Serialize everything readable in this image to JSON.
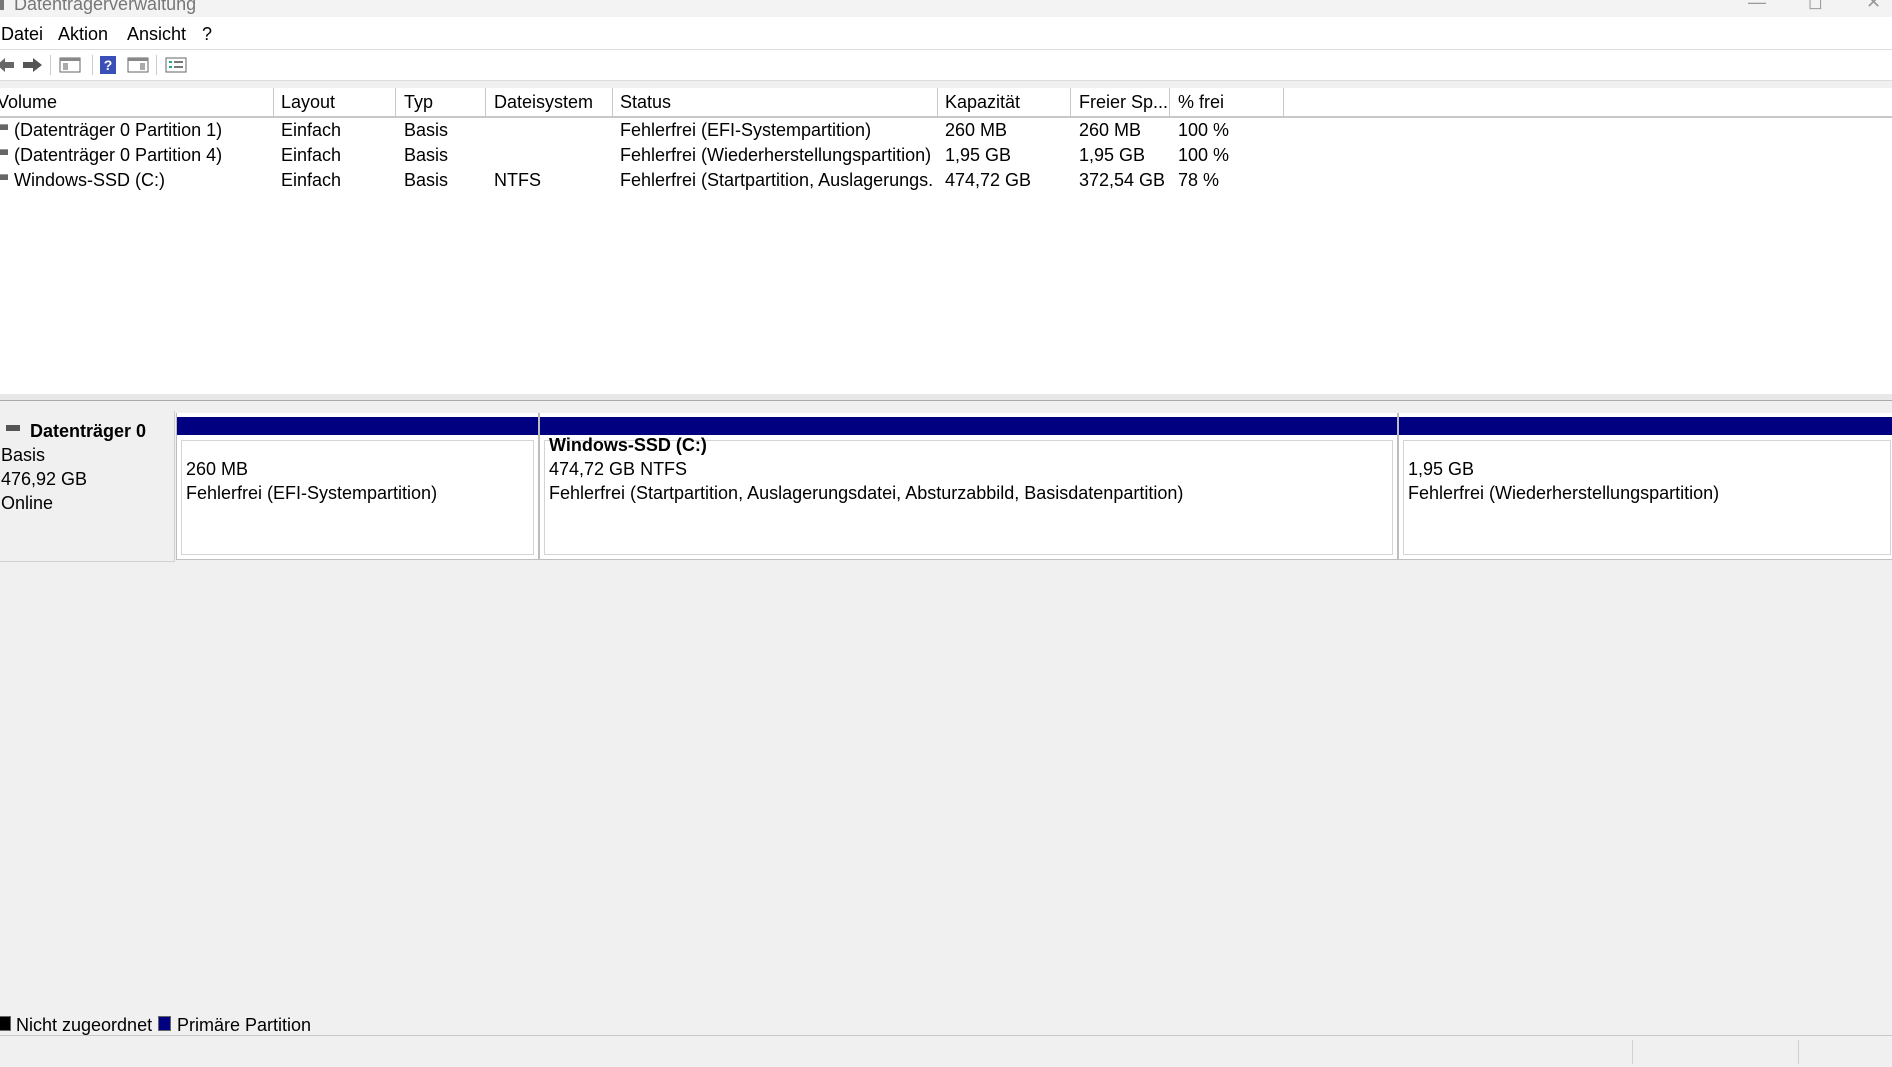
{
  "window": {
    "title": "Datenträgerverwaltung",
    "minimize_symbol": "—",
    "maximize_symbol": "◻",
    "close_symbol": "✕"
  },
  "menu": [
    {
      "label": "Datei"
    },
    {
      "label": "Aktion"
    },
    {
      "label": "Ansicht"
    },
    {
      "label": "?"
    }
  ],
  "toolbar": {
    "buttons": [
      {
        "icon": "back-arrow-icon",
        "glyph": "⇦"
      },
      {
        "icon": "forward-arrow-icon",
        "glyph": "➡"
      },
      {
        "icon": "console-tree-icon",
        "glyph": "▤"
      },
      {
        "icon": "help-icon",
        "glyph": "?"
      },
      {
        "icon": "action-pane-icon",
        "glyph": "▥"
      },
      {
        "icon": "properties-icon",
        "glyph": "☰"
      }
    ]
  },
  "volume_list": {
    "columns": [
      "Volume",
      "Layout",
      "Typ",
      "Dateisystem",
      "Status",
      "Kapazität",
      "Freier Sp...",
      "% frei"
    ],
    "rows": [
      [
        "(Datenträger 0 Partition 1)",
        "Einfach",
        "Basis",
        "",
        "Fehlerfrei (EFI-Systempartition)",
        "260 MB",
        "260 MB",
        "100 %"
      ],
      [
        "(Datenträger 0 Partition 4)",
        "Einfach",
        "Basis",
        "",
        "Fehlerfrei (Wiederherstellungspartition)",
        "1,95 GB",
        "1,95 GB",
        "100 %"
      ],
      [
        "Windows-SSD (C:)",
        "Einfach",
        "Basis",
        "NTFS",
        "Fehlerfrei (Startpartition, Auslagerungs...",
        "474,72 GB",
        "372,54 GB",
        "78 %"
      ]
    ]
  },
  "disk": {
    "name": "Datenträger 0",
    "type": "Basis",
    "size": "476,92 GB",
    "state": "Online",
    "partitions": [
      {
        "name": "",
        "size": "260 MB",
        "status": "Fehlerfrei (EFI-Systempartition)"
      },
      {
        "name": "Windows-SSD  (C:)",
        "size": "474,72 GB NTFS",
        "status": "Fehlerfrei (Startpartition, Auslagerungsdatei, Absturzabbild, Basisdatenpartition)"
      },
      {
        "name": "",
        "size": "1,95 GB",
        "status": "Fehlerfrei (Wiederherstellungspartition)"
      }
    ]
  },
  "legend": [
    {
      "label": "Nicht zugeordnet",
      "color": "#000000"
    },
    {
      "label": "Primäre Partition",
      "color": "#000080"
    }
  ],
  "colors": {
    "primary_partition_bar": "#000080",
    "unallocated": "#000000"
  }
}
